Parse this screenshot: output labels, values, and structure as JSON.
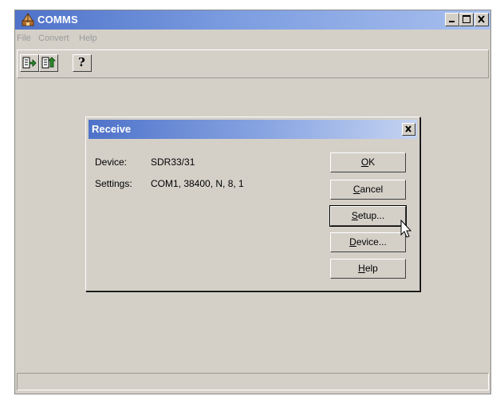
{
  "window": {
    "title": "COMMS",
    "accent": "#4e72c9"
  },
  "menu": [
    {
      "label": "File"
    },
    {
      "label": "Convert"
    },
    {
      "label": "Help"
    }
  ],
  "toolbar": {
    "buttons": [
      {
        "icon": "receive-icon"
      },
      {
        "icon": "send-icon"
      },
      {
        "icon": "help-icon",
        "glyph": "?"
      }
    ]
  },
  "dialog": {
    "title": "Receive",
    "device_label": "Device:",
    "device_value": "SDR33/31",
    "settings_label": "Settings:",
    "settings_value": "COM1, 38400, N, 8, 1",
    "buttons": {
      "ok": {
        "mnemonic": "O",
        "rest": "K"
      },
      "cancel": {
        "mnemonic": "C",
        "rest": "ancel"
      },
      "setup": {
        "mnemonic": "S",
        "rest": "etup..."
      },
      "device": {
        "mnemonic": "D",
        "rest": "evice..."
      },
      "help": {
        "mnemonic": "H",
        "rest": "elp"
      }
    }
  },
  "status_bar": {
    "text": ""
  }
}
